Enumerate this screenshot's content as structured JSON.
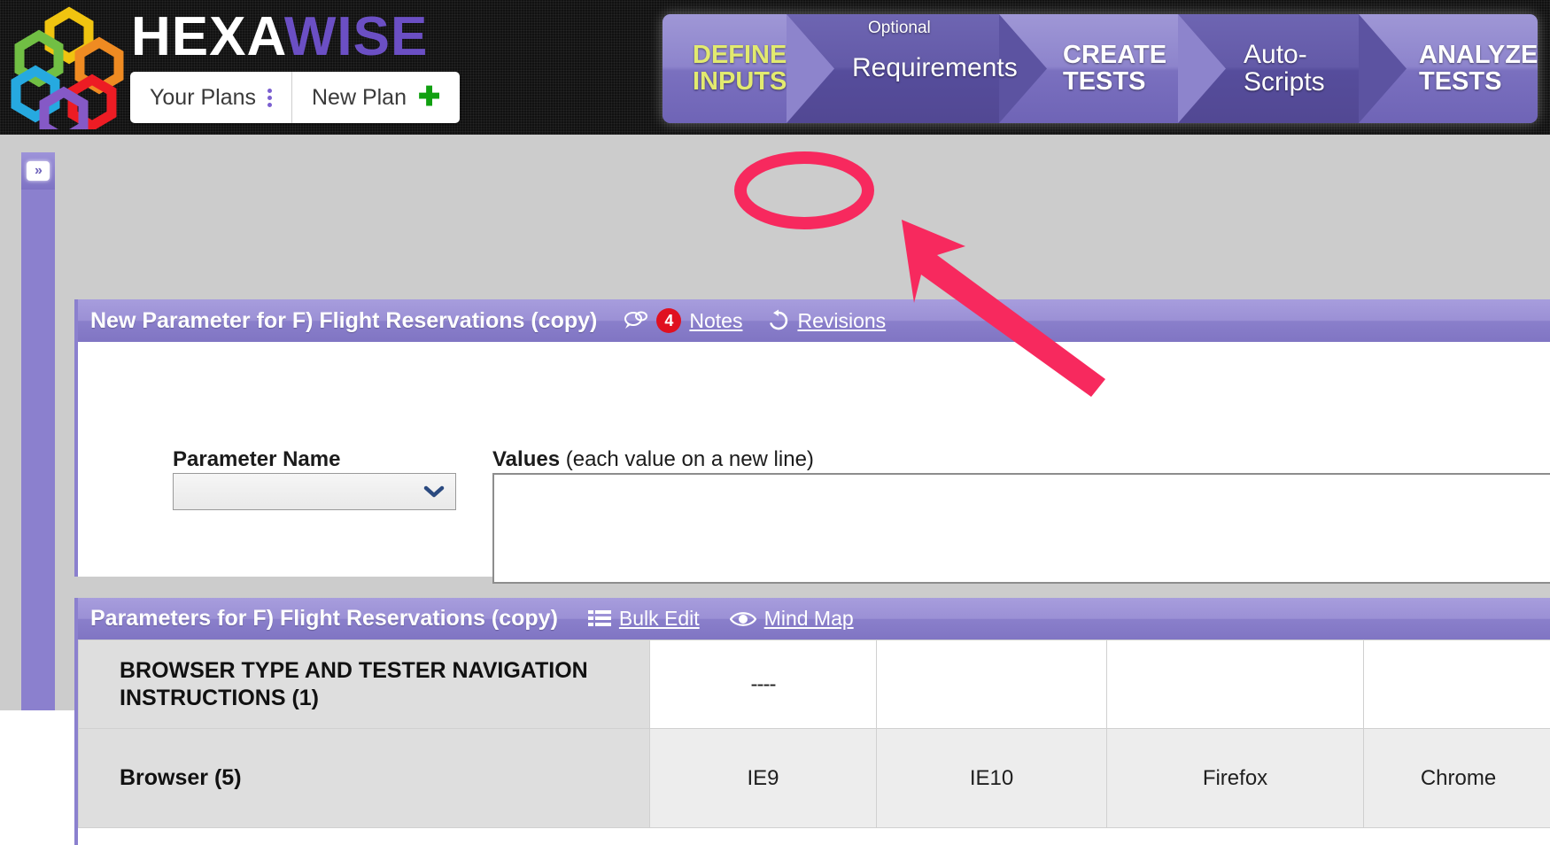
{
  "header": {
    "brand_part1": "HEXA",
    "brand_part2": "WISE",
    "brand_color_1": "#ffffff",
    "brand_color_2": "#6b4fc4",
    "your_plans_label": "Your Plans",
    "new_plan_label": "New Plan",
    "kebab_icon": "kebab-menu-icon",
    "plus_icon": "plus-icon",
    "plus_symbol": "✚",
    "logo_icon": "hexawise-hexagon-logo"
  },
  "steps": {
    "optional_label": "Optional",
    "items": [
      {
        "label": "DEFINE\nINPUTS",
        "line1": "DEFINE",
        "line2": "INPUTS",
        "active": true
      },
      {
        "label": "Requirements",
        "line1": "Requirements",
        "line2": "",
        "active": false
      },
      {
        "label": "CREATE TESTS",
        "line1": "CREATE",
        "line2": "TESTS",
        "active": false
      },
      {
        "label": "Auto-Scripts",
        "line1": "Auto-",
        "line2": "Scripts",
        "active": false
      },
      {
        "label": "ANALYZE TESTS",
        "line1": "ANALYZE",
        "line2": "TESTS",
        "active": false
      }
    ],
    "active_text_color": "#e2ea6f"
  },
  "sidebar": {
    "expand_button_label": "»",
    "expand_icon": "chevron-double-right-icon"
  },
  "new_parameter_panel": {
    "title": "New Parameter for F) Flight Reservations (copy)",
    "notes_label": "Notes",
    "notes_count": "4",
    "notes_badge_color": "#e01020",
    "notes_icon": "speech-bubble-icon",
    "revisions_label": "Revisions",
    "revisions_icon": "undo-history-icon",
    "parameter_name_label": "Parameter Name",
    "parameter_name_value": "",
    "parameter_name_placeholder": "",
    "values_label_bold": "Values",
    "values_label_rest": " (each value on a new line)",
    "values_textarea_value": "",
    "values_textarea_placeholder": "",
    "dropdown_caret_icon": "chevron-down-icon"
  },
  "parameters_panel": {
    "title": "Parameters for F) Flight Reservations (copy)",
    "bulk_edit_label": "Bulk Edit",
    "bulk_edit_icon": "list-lines-icon",
    "mind_map_label": "Mind Map",
    "mind_map_icon": "eye-icon",
    "rows": [
      {
        "name": "BROWSER TYPE AND TESTER NAVIGATION INSTRUCTIONS (1)",
        "name_line1": "BROWSER TYPE AND TESTER NAVIGATION",
        "name_line2": "INSTRUCTIONS (1)",
        "values": [
          "----",
          "",
          "",
          ""
        ]
      },
      {
        "name": "Browser (5)",
        "name_line1": "Browser (5)",
        "name_line2": "",
        "values": [
          "IE9",
          "IE10",
          "Firefox",
          "Chrome"
        ]
      }
    ]
  },
  "annotation": {
    "highlight_color": "#f7295e",
    "highlight_target": "revisions-link",
    "arrow_icon": "pointer-arrow-annotation",
    "ellipse_icon": "ellipse-highlight-annotation"
  }
}
